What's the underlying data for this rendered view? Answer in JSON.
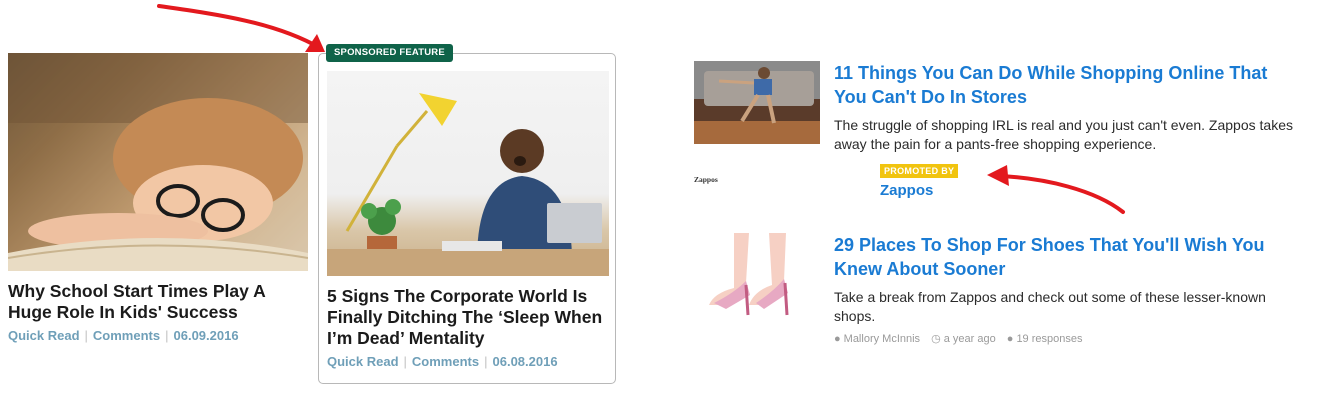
{
  "left_card": {
    "title": "Why School Start Times Play A Huge Role In Kids' Success",
    "meta": {
      "quick_read": "Quick Read",
      "comments": "Comments",
      "date": "06.09.2016",
      "sep": "|"
    }
  },
  "sponsored_card": {
    "badge": "SPONSORED FEATURE",
    "title": "5 Signs The Corporate World Is Finally Ditching The ‘Sleep When I’m Dead’ Mentality",
    "meta": {
      "quick_read": "Quick Read",
      "comments": "Comments",
      "date": "06.08.2016",
      "sep": "|"
    }
  },
  "right_items": [
    {
      "title": "11 Things You Can Do While Shopping Online That You Can't Do In Stores",
      "description": "The struggle of shopping IRL is real and you just can't even. Zappos takes away the pain for a pants-free shopping experience.",
      "promo_badge": "PROMOTED BY",
      "promo_name": "Zappos",
      "promo_logo": "Zappos"
    },
    {
      "title": "29 Places To Shop For Shoes That You'll Wish You Knew About Sooner",
      "description": "Take a break from Zappos and check out some of these lesser-known shops.",
      "author": "Mallory McInnis",
      "time": "a year ago",
      "responses": "19 responses"
    }
  ],
  "colors": {
    "sponsored_badge": "#0f6349",
    "promoted_badge": "#f1c40f",
    "link_blue": "#1a7bd3",
    "meta_blue": "#6f9fb8",
    "arrow_red": "#e3191e"
  },
  "icons": [
    "user-icon",
    "clock-icon",
    "speech-bubble-icon"
  ]
}
